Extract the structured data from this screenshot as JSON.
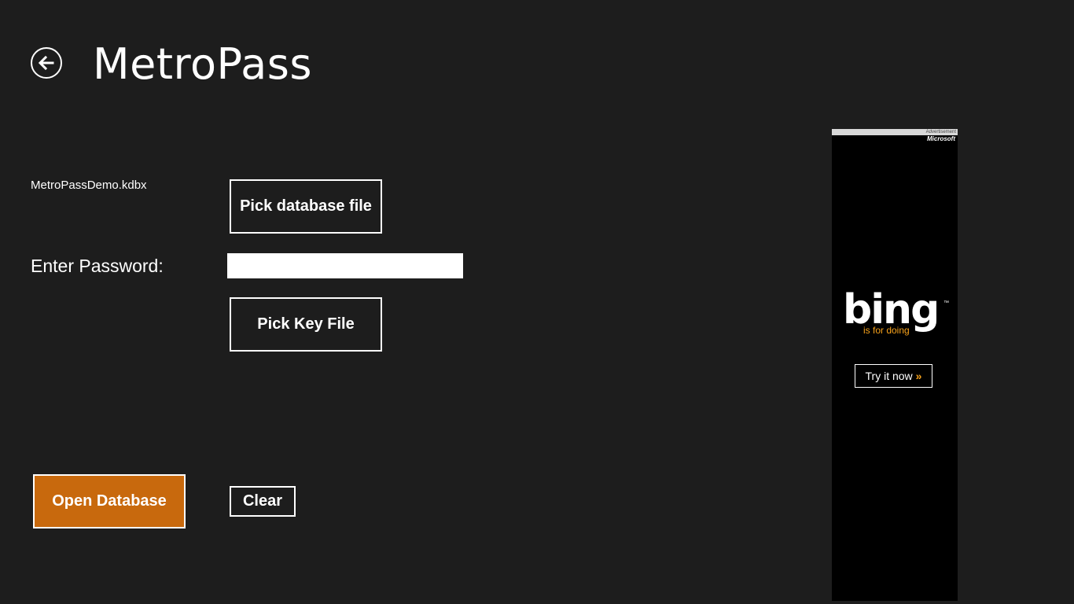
{
  "app": {
    "title": "MetroPass"
  },
  "database": {
    "file_name": "MetroPassDemo.kdbx",
    "pick_db_label": "Pick database file"
  },
  "password": {
    "label": "Enter Password:",
    "value": ""
  },
  "keyfile": {
    "pick_key_label": "Pick Key File"
  },
  "actions": {
    "open_label": "Open Database",
    "clear_label": "Clear"
  },
  "ad": {
    "label": "Advertisement",
    "brand": "Microsoft",
    "logo_text": "bing",
    "trademark": "™",
    "tagline": "is for doing",
    "cta_label": "Try it now",
    "cta_chevron": "»"
  },
  "colors": {
    "background": "#1d1d1d",
    "accent": "#c8690d",
    "bing_orange": "#f7a21b"
  },
  "icons": {
    "back": "back-arrow-icon"
  }
}
